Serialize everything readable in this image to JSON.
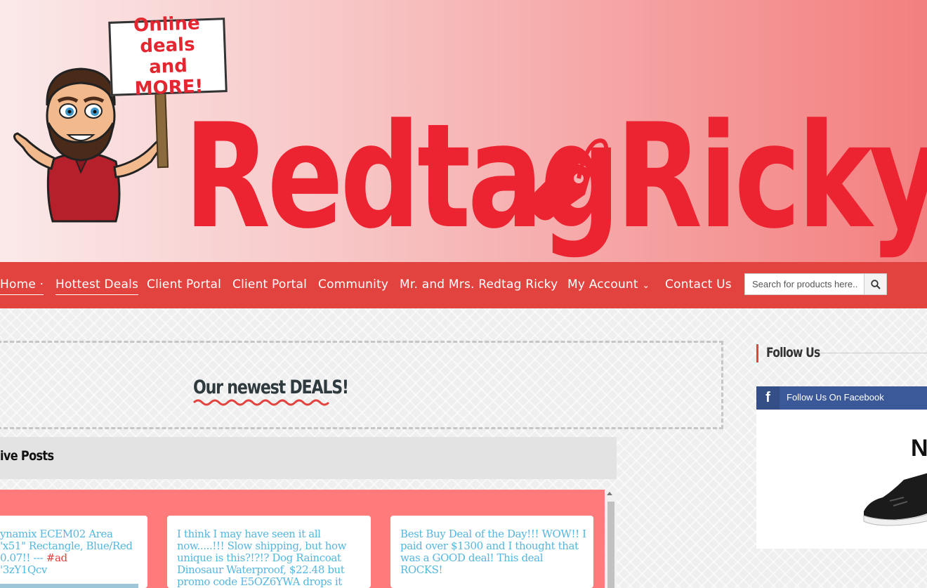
{
  "header": {
    "logo_word_1": "Redtag",
    "logo_word_2": "Ricky",
    "sign_line_1": "Online deals",
    "sign_line_2": "and MORE!"
  },
  "nav": {
    "items": [
      {
        "label": "Home ·"
      },
      {
        "label": "Hottest Deals"
      },
      {
        "label": "Client Portal"
      },
      {
        "label": "Client Portal"
      },
      {
        "label": "Community"
      },
      {
        "label": "Mr. and Mrs. Redtag Ricky"
      },
      {
        "label": "My Account"
      },
      {
        "label": "Contact Us"
      }
    ],
    "search_placeholder": "Search for products here..."
  },
  "main": {
    "deals_title": "Our newest DEALS!",
    "archive_title": "ive Posts",
    "posts": [
      {
        "text": "ynamix ECEM02 Area\n'x51\" Rectangle, Blue/Red\n0.07!! --- ",
        "tag": "#ad",
        "after": "\n'3zY1Qcv"
      },
      {
        "text": "I think I may have seen it all now.....!!! Slow shipping, but how unique is this?!?!? Dog Raincoat Dinosaur Waterproof, $22.48 but promo code E5OZ6YWA drops it"
      },
      {
        "text": "Best Buy Deal of the Day!!! WOW!! I paid over $1300 and I thought that was a GOOD deal! This deal ROCKS!"
      }
    ]
  },
  "sidebar": {
    "follow_heading": "Follow Us",
    "facebook_label": "Follow Us On Facebook",
    "ad_letter": "N"
  },
  "colors": {
    "brand_red": "#ec2330",
    "nav_bg": "#e2433f",
    "posts_panel": "#ff7b7b",
    "post_text": "#55b6df",
    "facebook": "#3b5998"
  }
}
